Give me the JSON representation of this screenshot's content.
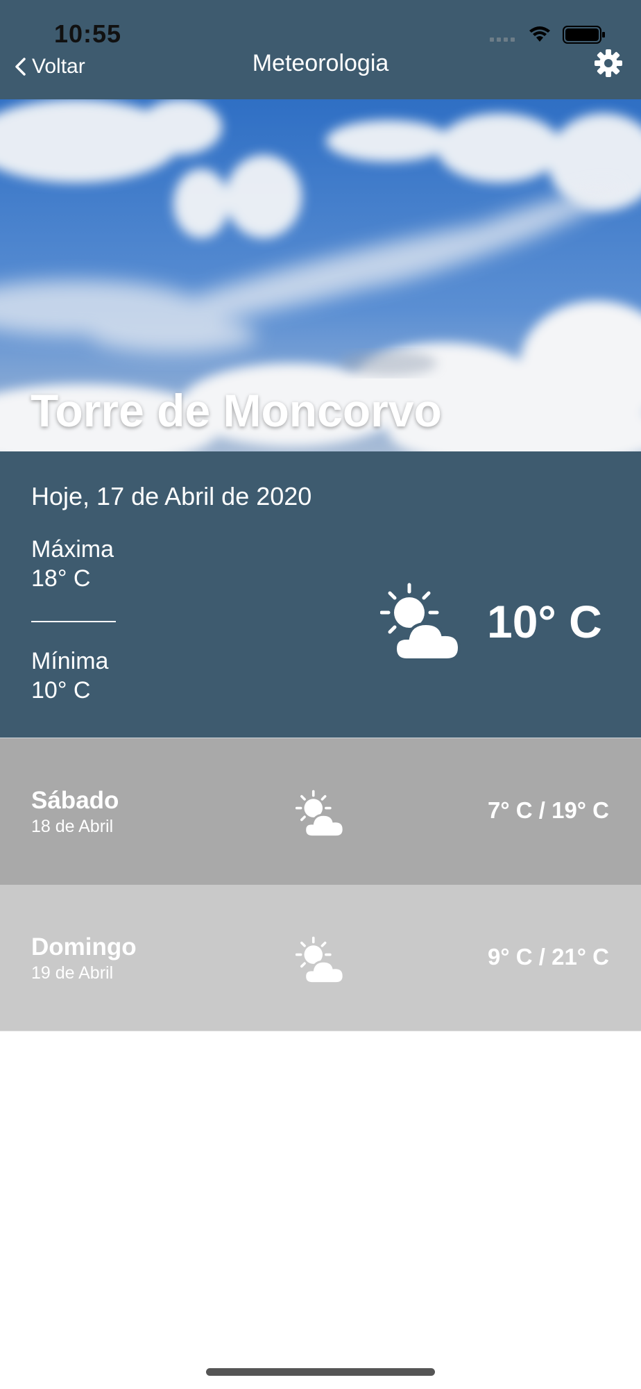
{
  "status_bar": {
    "time": "10:55"
  },
  "nav": {
    "back_label": "Voltar",
    "title": "Meteorologia"
  },
  "hero": {
    "city": "Torre de Moncorvo"
  },
  "today": {
    "date": "Hoje, 17 de Abril de 2020",
    "max_label": "Máxima",
    "max_value": "18° C",
    "divider": "________",
    "min_label": "Mínima",
    "min_value": "10° C",
    "current_temp": "10° C",
    "icon": "partly-sunny-icon"
  },
  "forecast": [
    {
      "day": "Sábado",
      "date": "18 de Abril",
      "temps": "7° C / 19° C",
      "icon": "partly-sunny-icon"
    },
    {
      "day": "Domingo",
      "date": "19 de Abril",
      "temps": "9° C / 21° C",
      "icon": "partly-sunny-icon"
    }
  ],
  "colors": {
    "header_bg": "#3e5b6f",
    "row1_bg": "#a9a9a9",
    "row2_bg": "#c9c9c9"
  }
}
